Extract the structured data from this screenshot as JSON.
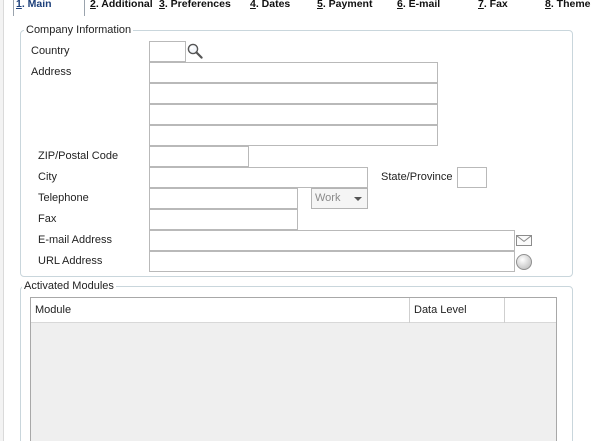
{
  "tabs": [
    {
      "mnemonic": "1",
      "label": ". Main",
      "active": true
    },
    {
      "mnemonic": "2",
      "label": ". Additional"
    },
    {
      "mnemonic": "3",
      "label": ". Preferences"
    },
    {
      "mnemonic": "4",
      "label": ". Dates"
    },
    {
      "mnemonic": "5",
      "label": ". Payment"
    },
    {
      "mnemonic": "6",
      "label": ". E-mail"
    },
    {
      "mnemonic": "7",
      "label": ". Fax"
    },
    {
      "mnemonic": "8",
      "label": ". Theme"
    }
  ],
  "company_info": {
    "title": "Company Information",
    "labels": {
      "country": "Country",
      "address": "Address",
      "zip": "ZIP/Postal Code",
      "city": "City",
      "state": "State/Province",
      "telephone": "Telephone",
      "fax": "Fax",
      "email": "E-mail Address",
      "url": "URL Address"
    },
    "values": {
      "country": "",
      "address_1": "",
      "address_2": "",
      "address_3": "",
      "address_4": "",
      "zip": "",
      "city": "",
      "state": "",
      "telephone": "",
      "fax": "",
      "email": "",
      "url": ""
    },
    "phone_type_selected": "Work",
    "icons": {
      "country_lookup": "magnifier-icon",
      "email": "envelope-icon",
      "url": "globe-icon"
    }
  },
  "activated_modules": {
    "title": "Activated Modules",
    "columns": [
      "Module",
      "Data Level"
    ],
    "rows": []
  }
}
